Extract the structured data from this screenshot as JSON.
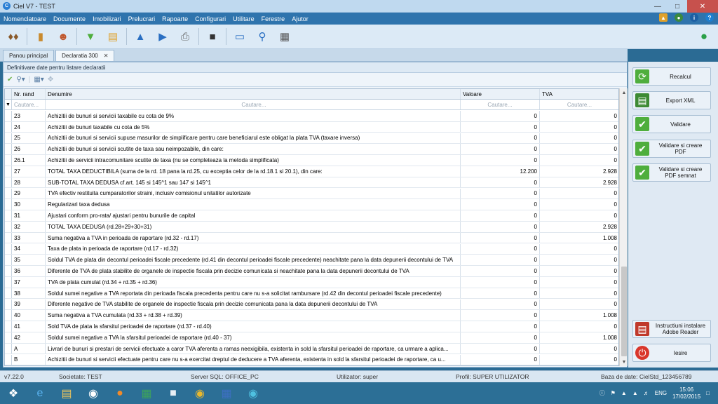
{
  "window": {
    "title": "Ciel V7 - TEST"
  },
  "menu": [
    "Nomenclatoare",
    "Documente",
    "Imobilizari",
    "Prelucrari",
    "Rapoarte",
    "Configurari",
    "Utilitare",
    "Ferestre",
    "Ajutor"
  ],
  "tabs": [
    {
      "label": "Panou principal"
    },
    {
      "label": "Declaratia 300"
    }
  ],
  "subheader": "Definitivare date pentru listare declaratii",
  "grid": {
    "headers": [
      "Nr. rand",
      "Denumire",
      "Valoare",
      "TVA"
    ],
    "search_placeholder": "Cautare...",
    "rows": [
      [
        "23",
        "Achizitii de bunuri si servicii taxabile cu cota de 9%",
        "0",
        "0"
      ],
      [
        "24",
        "Achizitii de bunuri taxabile cu cota de 5%",
        "0",
        "0"
      ],
      [
        "25",
        "Achizitii de bunuri si servicii supuse masurilor de simplificare pentru care beneficiarul este obligat la plata TVA (taxare inversa)",
        "0",
        "0"
      ],
      [
        "26",
        "Achizitii de bunuri si servicii scutite de taxa sau neimpozabile, din care:",
        "0",
        "0"
      ],
      [
        "26.1",
        "Achizitii de servicii intracomunitare scutite de taxa (nu se completeaza la metoda simplificata)",
        "0",
        "0"
      ],
      [
        "27",
        "TOTAL TAXA DEDUCTIBILA (suma de la rd. 18 pana la rd.25, cu exceptia celor de la rd.18.1 si 20.1), din care:",
        "12.200",
        "2.928"
      ],
      [
        "28",
        "SUB-TOTAL TAXA DEDUSA cf.art. 145 si 145^1 sau 147 si 145^1",
        "0",
        "2.928"
      ],
      [
        "29",
        "TVA efectiv restituita cumparatorilor straini, inclusiv comisionul unitatilor autorizate",
        "0",
        "0"
      ],
      [
        "30",
        "Regularizari taxa dedusa",
        "0",
        "0"
      ],
      [
        "31",
        "Ajustari conform pro-rata/ ajustari pentru bunurile de capital",
        "0",
        "0"
      ],
      [
        "32",
        "TOTAL TAXA DEDUSA (rd.28+29+30+31)",
        "0",
        "2.928"
      ],
      [
        "33",
        "Suma negativa a TVA in perioada de raportare (rd.32 - rd.17)",
        "0",
        "1.008"
      ],
      [
        "34",
        "Taxa de plata in perioada de raportare (rd.17 - rd.32)",
        "0",
        "0"
      ],
      [
        "35",
        "Soldul TVA de plata din decontul perioadei fiscale precedente (rd.41 din decontul perioadei fiscale precedente) neachitate pana la data depunerii decontului de TVA",
        "0",
        "0"
      ],
      [
        "36",
        "Diferente de TVA de plata stabilite de organele de inspectie fiscala prin decizie comunicata si neachitate pana la data depunerii decontului de TVA",
        "0",
        "0"
      ],
      [
        "37",
        "TVA de plata cumulat (rd.34 + rd.35 + rd.36)",
        "0",
        "0"
      ],
      [
        "38",
        "Soldul sumei negative a TVA reportata din perioada fiscala precedenta pentru care nu s-a solicitat rambursare (rd.42 din decontul perioadei fiscale precedente)",
        "0",
        "0"
      ],
      [
        "39",
        "Diferente negative de TVA  stabilite de organele de inspectie fiscala prin decizie comunicata pana la data depunerii decontului de TVA",
        "0",
        "0"
      ],
      [
        "40",
        "Suma negativa a TVA cumulata (rd.33 + rd.38 + rd.39)",
        "0",
        "1.008"
      ],
      [
        "41",
        "Sold TVA de plata la sfarsitul perioadei de raportare (rd.37 - rd.40)",
        "0",
        "0"
      ],
      [
        "42",
        "Soldul sumei negative a TVA la sfarsitul perioadei de raportare (rd.40 - 37)",
        "0",
        "1.008"
      ],
      [
        "A",
        "Livrari de bunuri si prestari de servicii efectuate a caror TVA aferenta a ramas neexigibila, existenta in sold la sfarsitul perioadei de raportare, ca urmare a aplica...",
        "0",
        "0"
      ],
      [
        "B",
        "Achizitii de bunuri si servicii efectuate pentru care nu s-a exercitat dreptul de deducere a TVA aferenta, existenta in sold la sfarsitul perioadei de raportare, ca u...",
        "0",
        "0"
      ]
    ]
  },
  "side_buttons": [
    {
      "label": "Recalcul",
      "icon": "refresh-icon",
      "color": "#4fae3d"
    },
    {
      "label": "Export XML",
      "icon": "xml-icon",
      "color": "#3d8a34"
    },
    {
      "label": "Validare",
      "icon": "check-icon",
      "color": "#4fae3d"
    },
    {
      "label": "Validare si creare PDF",
      "icon": "check-icon",
      "color": "#4fae3d"
    },
    {
      "label": "Validare si creare PDF semnat",
      "icon": "check-icon",
      "color": "#4fae3d"
    },
    {
      "label": "Instructiuni instalare Adobe Reader",
      "icon": "pdf-icon",
      "color": "#c0392b"
    },
    {
      "label": "Iesire",
      "icon": "power-icon",
      "color": "#d9362b"
    }
  ],
  "status": {
    "version": "v7.22.0",
    "company": "Societate: TEST",
    "server": "Server SQL: OFFICE_PC",
    "user": "Utilizator: super",
    "profile": "Profil: SUPER UTILIZATOR",
    "database": "Baza de date: CielStd_123456789"
  },
  "tray": {
    "lang": "ENG",
    "time": "15:06",
    "date": "17/02/2015"
  }
}
